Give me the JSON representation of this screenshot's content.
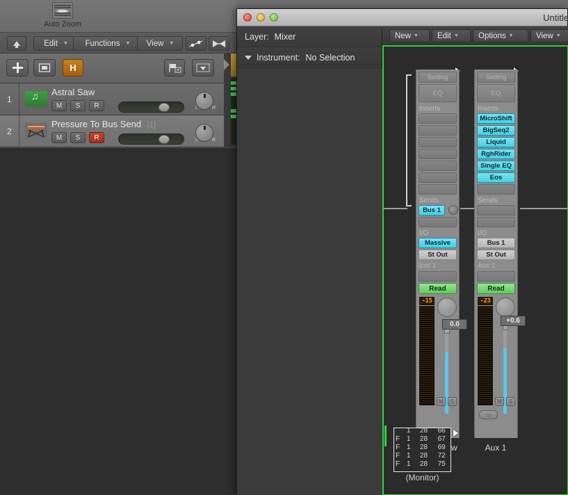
{
  "arrange": {
    "toolbar": {
      "auto_zoom_label": "Auto Zoom",
      "auto_zoom_icon": "waveform-zoom-icon"
    },
    "menubar": {
      "up_icon": "up-arrow-icon",
      "items": [
        {
          "label": "Edit",
          "arrow": "▼"
        },
        {
          "label": "Functions",
          "arrow": "▼"
        },
        {
          "label": "View",
          "arrow": "▼"
        }
      ],
      "automation_icon": "automation-node-icon",
      "flex_icon": "flex-bowtie-icon"
    },
    "trackbar": {
      "add_label": "+",
      "duplicate_icon": "duplicate-track-icon",
      "hide_label": "H",
      "flag_icon": "track-protect-icon",
      "chevron_icon": "chevron-down-icon"
    },
    "tracks": [
      {
        "number": "1",
        "name": "Astral Saw",
        "suffix": "",
        "icon": "midi-region-icon",
        "mute_label": "M",
        "solo_label": "S",
        "rec_label": "R",
        "rec_armed": false,
        "pan_left": "L",
        "pan_right": "R"
      },
      {
        "number": "2",
        "name": "Pressure To Bus Send",
        "suffix": "[1]",
        "icon": "keyboard-stand-icon",
        "mute_label": "M",
        "solo_label": "S",
        "rec_label": "R",
        "rec_armed": true,
        "pan_left": "L",
        "pan_right": "R"
      }
    ]
  },
  "mixer_window": {
    "title": "Untitle",
    "traffic_lights": [
      "close-button",
      "minimize-button",
      "zoom-button"
    ],
    "inspector": {
      "layer_row": {
        "label": "Layer:",
        "value": "Mixer"
      },
      "instrument_row": {
        "label": "Instrument:",
        "value": "No Selection"
      }
    },
    "menubar": [
      {
        "label": "New",
        "arrow": "▼"
      },
      {
        "label": "Edit",
        "arrow": "▼"
      },
      {
        "label": "Options",
        "arrow": "▼"
      },
      {
        "label": "View",
        "arrow": "▼"
      }
    ],
    "selection_color": "#35d13c",
    "strips": [
      {
        "name": "Astral Saw",
        "setting_label": "Setting",
        "eq_label": "EQ",
        "inserts_header": "Inserts",
        "inserts": [
          "",
          "",
          "",
          "",
          "",
          "",
          ""
        ],
        "sends_header": "Sends",
        "sends": [
          "Bus 1",
          ""
        ],
        "io_header": "I/O",
        "input": "Massive",
        "output": "St Out",
        "group_label": "Inst 1",
        "group_slot": "",
        "automation_mode": "Read",
        "peak_value": "-15",
        "fader_value": "0.0",
        "mute_label": "M",
        "solo_label": "S",
        "has_stereo_button": false
      },
      {
        "name": "Aux 1",
        "setting_label": "Setting",
        "eq_label": "EQ",
        "inserts_header": "Inserts",
        "inserts": [
          "MicroShift",
          "BigSeq2",
          "Liquid",
          "RghRider",
          "Single EQ",
          "Eos",
          ""
        ],
        "sends_header": "Sends",
        "sends": [
          "",
          ""
        ],
        "io_header": "I/O",
        "input": "Bus 1",
        "output": "St Out",
        "group_label": "Aux 1",
        "group_slot": "",
        "automation_mode": "Read",
        "peak_value": "-23",
        "fader_value": "+0.6",
        "mute_label": "M",
        "solo_label": "S",
        "has_stereo_button": true,
        "stereo_icon": "stereo-pair-icon"
      }
    ],
    "monitor": {
      "label": "(Monitor)",
      "rows": [
        {
          "c1": "",
          "c2": "1",
          "c3": "28",
          "c4": "66"
        },
        {
          "c1": "F",
          "c2": "1",
          "c3": "28",
          "c4": "67"
        },
        {
          "c1": "F",
          "c2": "1",
          "c3": "28",
          "c4": "69"
        },
        {
          "c1": "F",
          "c2": "1",
          "c3": "28",
          "c4": "72"
        },
        {
          "c1": "F",
          "c2": "1",
          "c3": "28",
          "c4": "75"
        }
      ]
    }
  }
}
